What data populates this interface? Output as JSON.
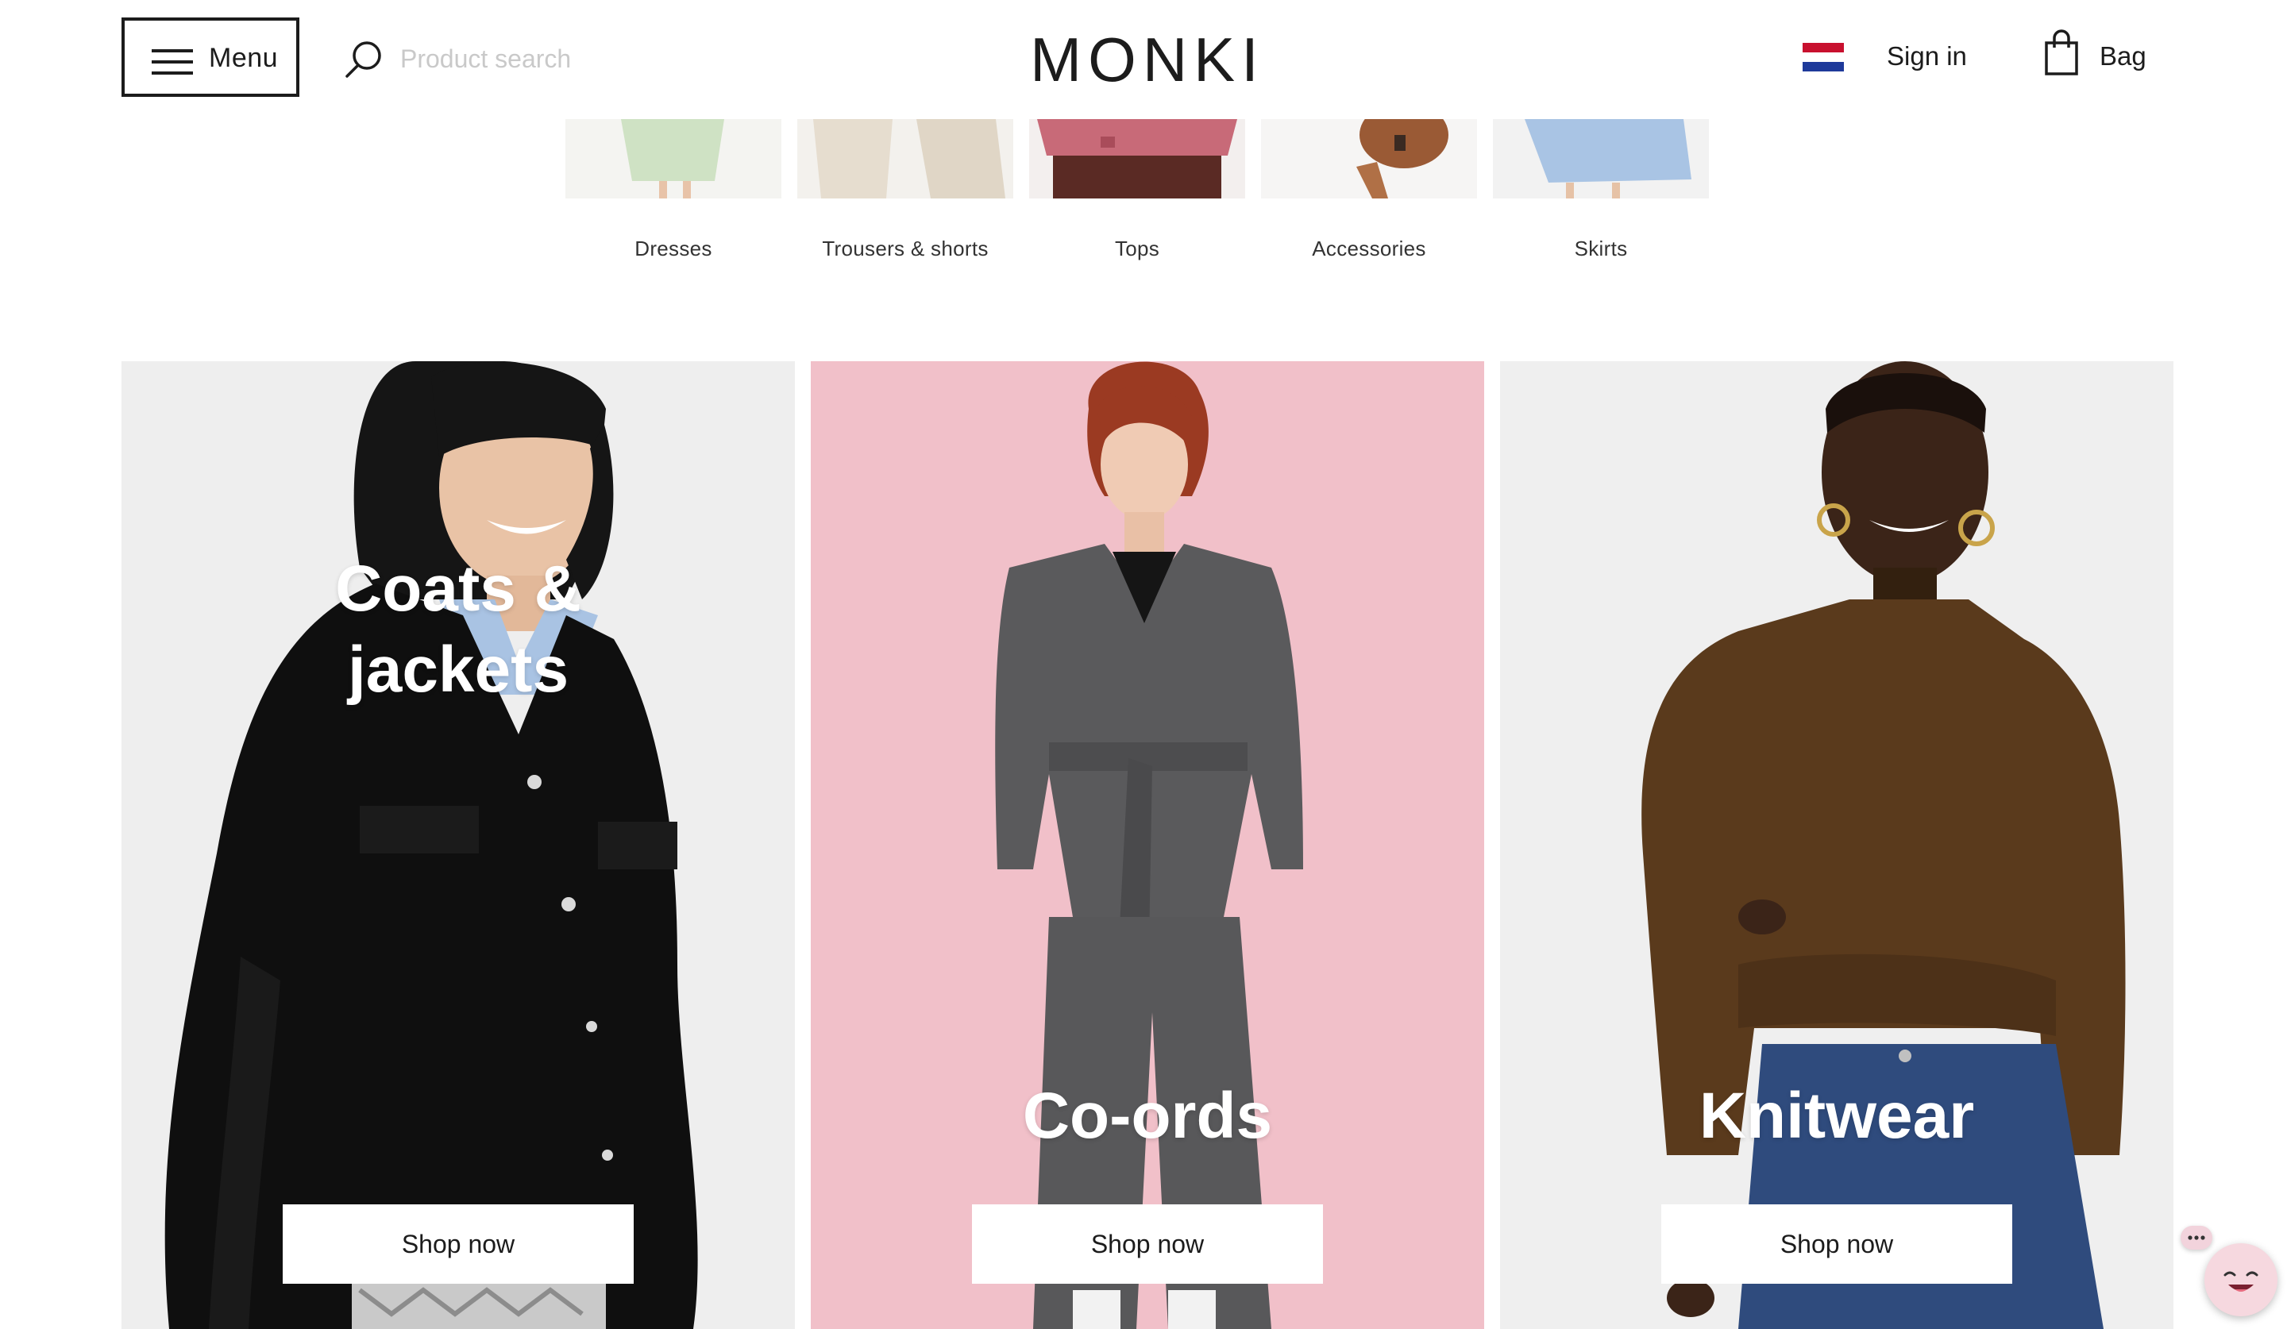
{
  "header": {
    "menu_label": "Menu",
    "search_placeholder": "Product search",
    "logo_text": "MONKI",
    "signin_label": "Sign in",
    "bag_label": "Bag"
  },
  "categories": [
    {
      "label": "Dresses",
      "thumb_color": "#cfe2c4"
    },
    {
      "label": "Trousers & shorts",
      "thumb_color": "#e6ddcf"
    },
    {
      "label": "Tops",
      "thumb_color": "#c86a78"
    },
    {
      "label": "Accessories",
      "thumb_color": "#9a5a35"
    },
    {
      "label": "Skirts",
      "thumb_color": "#a9c4e4"
    }
  ],
  "tiles": [
    {
      "title_line1": "Coats &",
      "title_line2": "jackets",
      "button": "Shop now",
      "bg": "#eeeeee"
    },
    {
      "title_line1": "",
      "title_line2": "Co-ords",
      "button": "Shop now",
      "bg": "#f1c0c9"
    },
    {
      "title_line1": "",
      "title_line2": "Knitwear",
      "button": "Shop now",
      "bg": "#efefef"
    }
  ],
  "colors": {
    "accent_text": "#1c1c1c",
    "flag_red": "#c8102e",
    "flag_white": "#ffffff",
    "flag_blue": "#1e3a9a",
    "chat_pink": "#f6d8df"
  },
  "chat": {
    "icon": "chat-smiley-icon"
  }
}
